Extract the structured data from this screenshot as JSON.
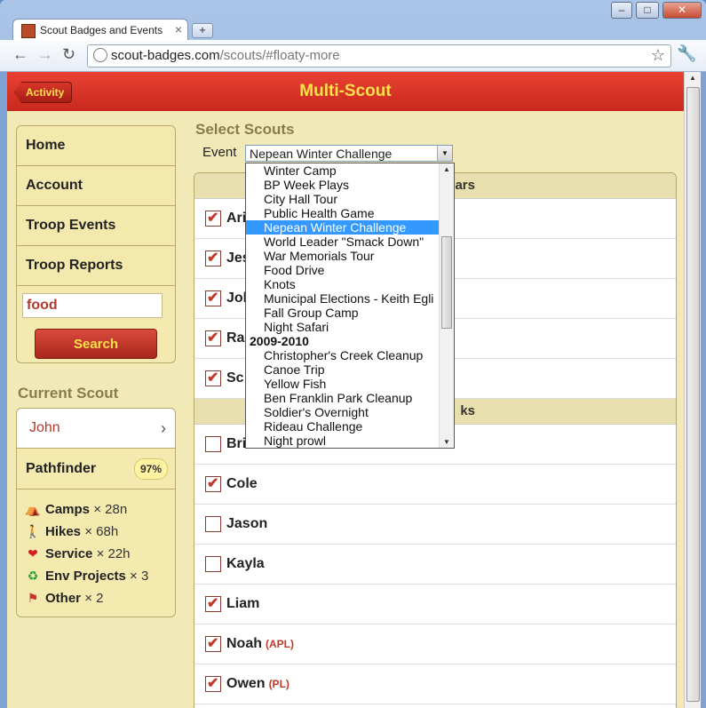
{
  "browser": {
    "tab_title": "Scout Badges and Events",
    "url_host": "scout-badges.com",
    "url_path": "/scouts/#floaty-more"
  },
  "app": {
    "back_label": "Activity",
    "title": "Multi-Scout"
  },
  "sidebar": {
    "items": [
      {
        "label": "Home"
      },
      {
        "label": "Account"
      },
      {
        "label": "Troop Events"
      },
      {
        "label": "Troop Reports"
      }
    ],
    "search_value": "food",
    "search_button": "Search"
  },
  "current_scout": {
    "heading": "Current Scout",
    "name": "John",
    "rank": "Pathfinder",
    "rank_pct": "97%",
    "stats": [
      {
        "icon": "tent-icon",
        "glyph": "⛺",
        "label": "Camps",
        "value": "× 28n"
      },
      {
        "icon": "hiker-icon",
        "glyph": "🚶",
        "label": "Hikes",
        "value": "× 68h"
      },
      {
        "icon": "heart-icon",
        "glyph": "❤",
        "label": "Service",
        "value": "× 22h"
      },
      {
        "icon": "recycle-icon",
        "glyph": "♻",
        "label": "Env Projects",
        "value": "× 3"
      },
      {
        "icon": "flag-icon",
        "glyph": "⚑",
        "label": "Other",
        "value": "× 2"
      }
    ]
  },
  "main": {
    "heading": "Select Scouts",
    "event_label": "Event",
    "event_selected": "Nepean Winter Challenge",
    "groups": [
      {
        "title": "ars",
        "rows": [
          {
            "name": "Ari",
            "checked": true,
            "role": ""
          },
          {
            "name": "Jes",
            "checked": true,
            "role": ""
          },
          {
            "name": "Joh",
            "checked": true,
            "role": ""
          },
          {
            "name": "Ra",
            "checked": true,
            "role": ""
          },
          {
            "name": "Sc",
            "checked": true,
            "role": ""
          }
        ]
      },
      {
        "title": "ks",
        "rows": [
          {
            "name": "Bri",
            "checked": false,
            "role": ""
          },
          {
            "name": "Cole",
            "checked": true,
            "role": ""
          },
          {
            "name": "Jason",
            "checked": false,
            "role": ""
          },
          {
            "name": "Kayla",
            "checked": false,
            "role": ""
          },
          {
            "name": "Liam",
            "checked": true,
            "role": ""
          },
          {
            "name": "Noah",
            "checked": true,
            "role": "(APL)"
          },
          {
            "name": "Owen",
            "checked": true,
            "role": "(PL)"
          }
        ]
      }
    ]
  },
  "dropdown": {
    "options": [
      {
        "type": "item",
        "label": "Winter Camp"
      },
      {
        "type": "item",
        "label": "BP Week Plays"
      },
      {
        "type": "item",
        "label": "City Hall Tour"
      },
      {
        "type": "item",
        "label": "Public Health Game"
      },
      {
        "type": "item",
        "label": "Nepean Winter Challenge",
        "selected": true
      },
      {
        "type": "item",
        "label": "World Leader \"Smack Down\""
      },
      {
        "type": "item",
        "label": "War Memorials Tour"
      },
      {
        "type": "item",
        "label": "Food Drive"
      },
      {
        "type": "item",
        "label": "Knots"
      },
      {
        "type": "item",
        "label": "Municipal Elections - Keith Egli"
      },
      {
        "type": "item",
        "label": "Fall Group Camp"
      },
      {
        "type": "item",
        "label": "Night Safari"
      },
      {
        "type": "group",
        "label": "2009-2010"
      },
      {
        "type": "item",
        "label": "Christopher's Creek Cleanup"
      },
      {
        "type": "item",
        "label": "Canoe Trip"
      },
      {
        "type": "item",
        "label": "Yellow Fish"
      },
      {
        "type": "item",
        "label": "Ben Franklin Park Cleanup"
      },
      {
        "type": "item",
        "label": "Soldier's Overnight"
      },
      {
        "type": "item",
        "label": "Rideau Challenge"
      },
      {
        "type": "item",
        "label": "Night prowl"
      }
    ]
  },
  "colors": {
    "appbar": "#d9322a",
    "title": "#ffe04d",
    "page_bg": "#f1eab6",
    "accent_red": "#c0392b",
    "selected": "#3399ff"
  }
}
